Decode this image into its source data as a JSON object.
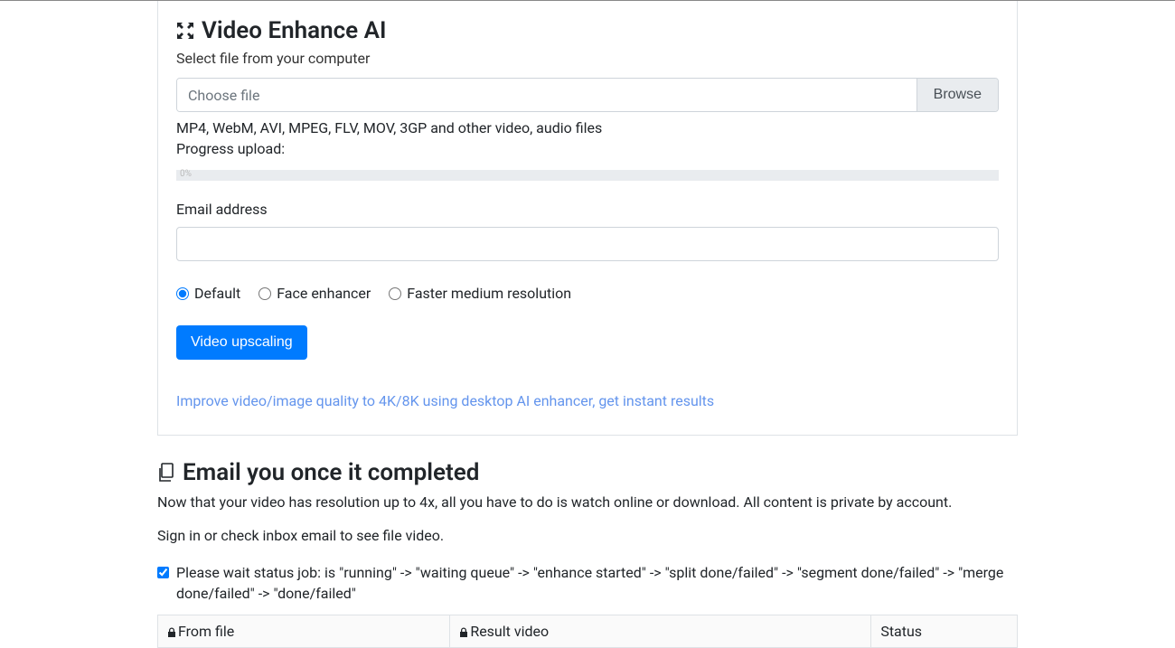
{
  "section1": {
    "title": "Video Enhance AI",
    "subtitle": "Select file from your computer",
    "file_placeholder": "Choose file",
    "browse_label": "Browse",
    "formats_hint": "MP4, WebM, AVI, MPEG, FLV, MOV, 3GP and other video, audio files",
    "progress_label": "Progress upload:",
    "progress_percent": "0%",
    "email_label": "Email address",
    "email_value": "",
    "radios": {
      "default": "Default",
      "face": "Face enhancer",
      "faster": "Faster medium resolution",
      "selected": "default"
    },
    "submit_label": "Video upscaling",
    "link_text": "Improve video/image quality to 4K/8K using desktop AI enhancer, get instant results"
  },
  "section2": {
    "title": "Email you once it completed",
    "subtitle": "Now that your video has resolution up to 4x, all you have to do is watch online or download. All content is private by account.",
    "signin_text": "Sign in or check inbox email to see file video.",
    "status_checked": true,
    "status_text": "Please wait status job: is \"running\" -> \"waiting queue\" -> \"enhance started\" -> \"split done/failed\" -> \"segment done/failed\" -> \"merge done/failed\" -> \"done/failed\"",
    "table": {
      "headers": [
        "From file",
        "Result video",
        "Status"
      ]
    }
  }
}
